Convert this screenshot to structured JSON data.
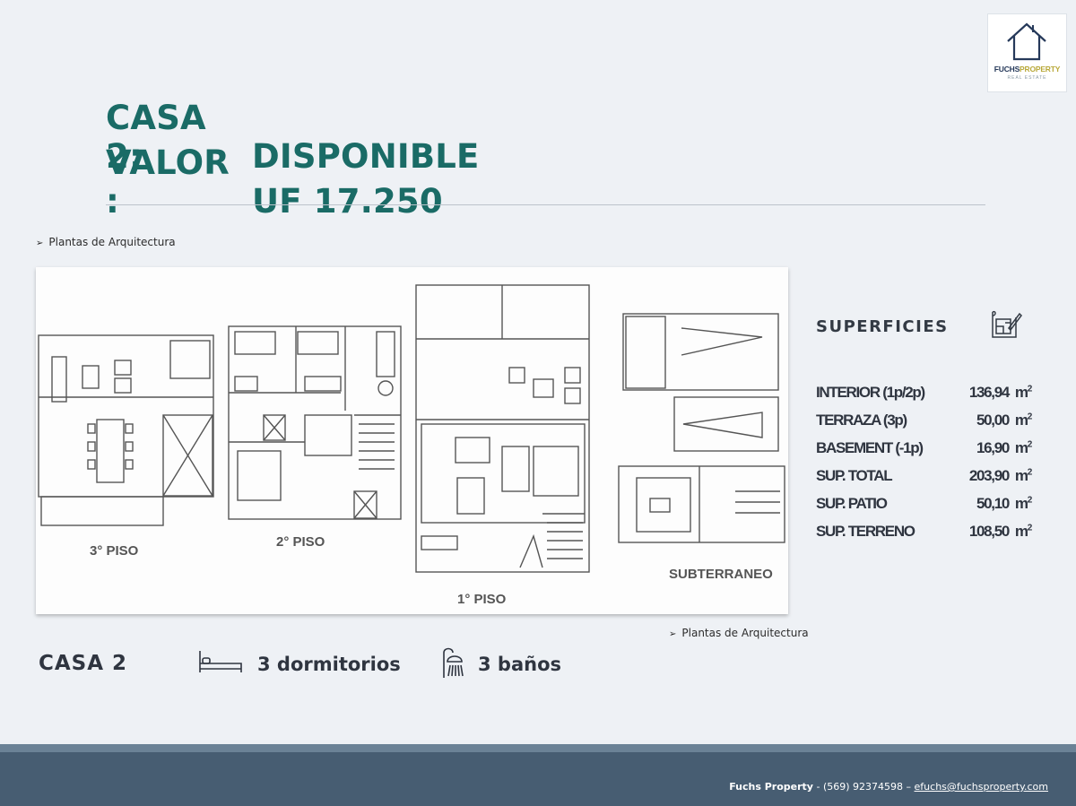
{
  "logo": {
    "text_main": "FUCHS",
    "text_accent": "PROPERTY",
    "text_sub": "REAL ESTATE"
  },
  "header": {
    "line1_label": "CASA 2:",
    "line1_value": "DISPONIBLE",
    "line2_label": "VALOR :",
    "line2_value": "UF 17.250"
  },
  "bullets": {
    "top": "Plantas de Arquitectura",
    "bottom": "Plantas de Arquitectura"
  },
  "floor_plan": {
    "labels": {
      "third": "3° PISO",
      "second": "2° PISO",
      "first": "1° PISO",
      "basement": "SUBTERRANEO"
    }
  },
  "superficies": {
    "title": "SUPERFICIES",
    "icon": "blueprint-icon",
    "unit": "m",
    "rows": [
      {
        "name": "INTERIOR (1p/2p)",
        "value": "136,94"
      },
      {
        "name": "TERRAZA (3p)",
        "value": "50,00"
      },
      {
        "name": "BASEMENT (-1p)",
        "value": "16,90"
      },
      {
        "name": "SUP. TOTAL",
        "value": "203,90"
      },
      {
        "name": "SUP.  PATIO",
        "value": "50,10"
      },
      {
        "name": "SUP.  TERRENO",
        "value": "108,50"
      }
    ]
  },
  "features": {
    "casa": "CASA 2",
    "bedrooms": "3 dormitorios",
    "bedrooms_icon": "bed-icon",
    "bathrooms": "3 baños",
    "bathrooms_icon": "shower-icon"
  },
  "footer": {
    "company": "Fuchs Property",
    "separator": " -  ",
    "phone": "(569) 92374598",
    "dash": " – ",
    "email": "efuchs@fuchsproperty.com"
  },
  "colors": {
    "title": "#1a6b66",
    "footer": "#475d72",
    "background": "#eef1f5"
  }
}
